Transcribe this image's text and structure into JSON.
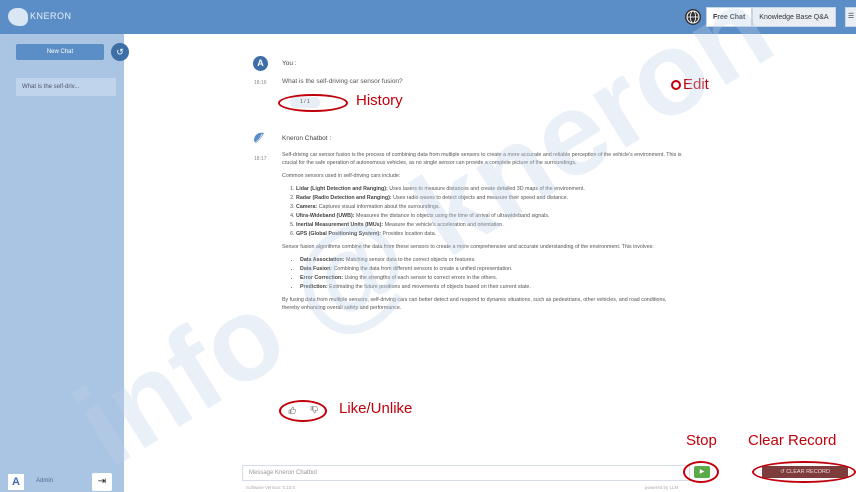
{
  "app": {
    "logo_text": "KNERON"
  },
  "header": {
    "tabs": [
      {
        "label": "Free Chat",
        "active": true
      },
      {
        "label": "Knowledge Base Q&A",
        "active": false
      }
    ],
    "menu_label": "☰",
    "globe_icon": "globe-icon"
  },
  "sidebar": {
    "new_chat_label": "New Chat",
    "collapse_icon": "↺",
    "history_items": [
      {
        "label": "What is the self-driv..."
      }
    ],
    "user_initial": "A",
    "user_name": "Admin",
    "logout_icon": "⇥"
  },
  "conversation": {
    "user": {
      "initial": "A",
      "sender": "You :",
      "time": "18:16",
      "question": "What is the self-driving car sensor fusion?",
      "history_counter": "1 / 1"
    },
    "bot": {
      "sender": "Kneron Chatbot :",
      "time": "18:17",
      "intro": "Self-driving car sensor fusion is the process of combining data from multiple sensors to create a more accurate and reliable perception of the vehicle's environment. This is crucial for the safe operation of autonomous vehicles, as no single sensor can provide a complete picture of the surroundings.",
      "sensors_heading": "Common sensors used in self-driving cars include:",
      "sensors": [
        {
          "name": "Lidar (Light Detection and Ranging):",
          "desc": "Uses lasers to measure distances and create detailed 3D maps of the environment."
        },
        {
          "name": "Radar (Radio Detection and Ranging):",
          "desc": "Uses radio waves to detect objects and measure their speed and distance."
        },
        {
          "name": "Camera:",
          "desc": "Captures visual information about the surroundings."
        },
        {
          "name": "Ultra-Wideband (UWB):",
          "desc": "Measures the distance to objects using the time of arrival of ultrawideband signals."
        },
        {
          "name": "Inertial Measurement Units (IMUs):",
          "desc": "Measure the vehicle's acceleration and orientation."
        },
        {
          "name": "GPS (Global Positioning System):",
          "desc": "Provides location data."
        }
      ],
      "fusion_heading": "Sensor fusion algorithms combine the data from these sensors to create a more comprehensive and accurate understanding of the environment. This involves:",
      "steps": [
        {
          "name": "Data Association:",
          "desc": "Matching sensor data to the correct objects or features."
        },
        {
          "name": "Data Fusion:",
          "desc": "Combining the data from different sensors to create a unified representation."
        },
        {
          "name": "Error Correction:",
          "desc": "Using the strengths of each sensor to correct errors in the others."
        },
        {
          "name": "Prediction:",
          "desc": "Estimating the future positions and movements of objects based on their current state."
        }
      ],
      "conclusion": "By fusing data from multiple sensors, self-driving cars can better detect and respond to dynamic situations, such as pedestrians, other vehicles, and road conditions, thereby enhancing overall safety and performance."
    }
  },
  "footer": {
    "input_placeholder": "Message Kneron Chatbot",
    "version_left": "Software Version: 0.10.0",
    "version_right": "powered by LLM",
    "stop_label": "▶",
    "clear_label": "↺ CLEAR RECORD"
  },
  "annotations": {
    "history": "History",
    "edit": "Edit",
    "like_unlike": "Like/Unlike",
    "stop": "Stop",
    "clear_record": "Clear Record"
  },
  "watermark_text": "info @ kneron",
  "colors": {
    "topbar": "#5b8ec7",
    "sidebar": "#aac4e3",
    "annotation": "#c0000a",
    "stop_button": "#5aaa4a",
    "clear_button": "#7e3c3c"
  }
}
